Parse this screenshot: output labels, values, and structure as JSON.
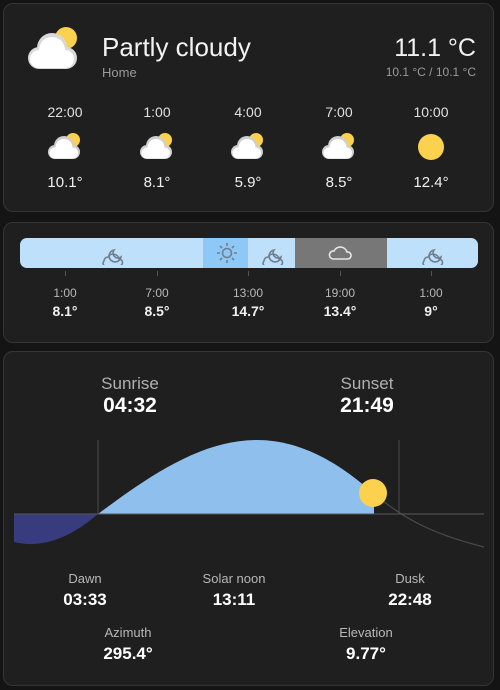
{
  "current": {
    "condition": "Partly cloudy",
    "location": "Home",
    "temperature": "11.1 °C",
    "range": "10.1 °C / 10.1 °C",
    "icon": "partly-cloudy-icon"
  },
  "forecast": [
    {
      "time": "22:00",
      "temp": "10.1°",
      "icon": "partly-cloudy-icon"
    },
    {
      "time": "1:00",
      "temp": "8.1°",
      "icon": "partly-cloudy-icon"
    },
    {
      "time": "4:00",
      "temp": "5.9°",
      "icon": "partly-cloudy-icon"
    },
    {
      "time": "7:00",
      "temp": "8.5°",
      "icon": "partly-cloudy-icon"
    },
    {
      "time": "10:00",
      "temp": "12.4°",
      "icon": "sun-icon"
    }
  ],
  "timeline": {
    "segments": [
      {
        "condition": "partly-cloudy-night",
        "color": "#bfe0fb",
        "icon": "partly-cloudy-night-icon"
      },
      {
        "condition": "sunny",
        "color": "#8ec8f7",
        "icon": "sun-icon"
      },
      {
        "condition": "partly-cloudy",
        "color": "#bfe0fb",
        "icon": "partly-cloudy-icon"
      },
      {
        "condition": "cloudy",
        "color": "#777777",
        "icon": "cloud-icon"
      },
      {
        "condition": "partly-cloudy-night",
        "color": "#bfe0fb",
        "icon": "partly-cloudy-night-icon"
      }
    ],
    "labels": [
      {
        "time": "1:00",
        "temp": "8.1°"
      },
      {
        "time": "7:00",
        "temp": "8.5°"
      },
      {
        "time": "13:00",
        "temp": "14.7°"
      },
      {
        "time": "19:00",
        "temp": "13.4°"
      },
      {
        "time": "1:00",
        "temp": "9°"
      }
    ]
  },
  "sun": {
    "sunrise_label": "Sunrise",
    "sunrise": "04:32",
    "sunset_label": "Sunset",
    "sunset": "21:49",
    "dawn_label": "Dawn",
    "dawn": "03:33",
    "noon_label": "Solar noon",
    "noon": "13:11",
    "dusk_label": "Dusk",
    "dusk": "22:48",
    "azimuth_label": "Azimuth",
    "azimuth": "295.4°",
    "elevation_label": "Elevation",
    "elevation": "9.77°",
    "colors": {
      "day": "#8fbfec",
      "night": "#383c7e",
      "sun": "#fcd14e"
    }
  }
}
